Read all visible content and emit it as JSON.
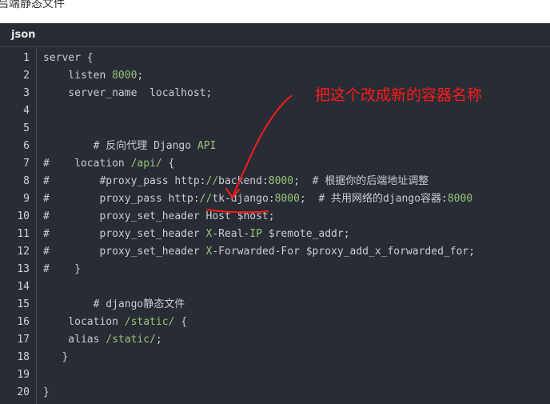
{
  "page": {
    "top_text": "吕端静态文件"
  },
  "code_block": {
    "language": "json",
    "lines": [
      {
        "n": "1",
        "tokens": [
          {
            "t": "server {",
            "c": "t-plain"
          }
        ]
      },
      {
        "n": "2",
        "tokens": [
          {
            "t": "    listen ",
            "c": "t-plain"
          },
          {
            "t": "8000",
            "c": "t-num"
          },
          {
            "t": ";",
            "c": "t-plain"
          }
        ]
      },
      {
        "n": "3",
        "tokens": [
          {
            "t": "    server_name  localhost;",
            "c": "t-plain"
          }
        ]
      },
      {
        "n": "4",
        "tokens": []
      },
      {
        "n": "5",
        "tokens": []
      },
      {
        "n": "6",
        "tokens": [
          {
            "t": "        # 反向代理 Django ",
            "c": "t-plain"
          },
          {
            "t": "API",
            "c": "t-green"
          }
        ]
      },
      {
        "n": "7",
        "tokens": [
          {
            "t": "#    location ",
            "c": "t-plain"
          },
          {
            "t": "/api/",
            "c": "t-green"
          },
          {
            "t": " {",
            "c": "t-plain"
          }
        ]
      },
      {
        "n": "8",
        "tokens": [
          {
            "t": "#        #proxy_pass http:",
            "c": "t-plain"
          },
          {
            "t": "//",
            "c": "t-green"
          },
          {
            "t": "backend:",
            "c": "t-plain"
          },
          {
            "t": "8000",
            "c": "t-num"
          },
          {
            "t": ";  # 根据你的后端地址调整",
            "c": "t-plain"
          }
        ]
      },
      {
        "n": "9",
        "tokens": [
          {
            "t": "#        proxy_pass http:",
            "c": "t-plain"
          },
          {
            "t": "//",
            "c": "t-green"
          },
          {
            "t": "tk-django:",
            "c": "t-plain"
          },
          {
            "t": "8000",
            "c": "t-num"
          },
          {
            "t": ";  # 共用网络的django容器:",
            "c": "t-plain"
          },
          {
            "t": "8000",
            "c": "t-num"
          }
        ]
      },
      {
        "n": "10",
        "tokens": [
          {
            "t": "#        proxy_set_header Host $host;",
            "c": "t-plain"
          }
        ]
      },
      {
        "n": "11",
        "tokens": [
          {
            "t": "#        proxy_set_header ",
            "c": "t-plain"
          },
          {
            "t": "X",
            "c": "t-green"
          },
          {
            "t": "-Real-",
            "c": "t-plain"
          },
          {
            "t": "IP",
            "c": "t-green"
          },
          {
            "t": " $remote_addr;",
            "c": "t-plain"
          }
        ]
      },
      {
        "n": "12",
        "tokens": [
          {
            "t": "#        proxy_set_header ",
            "c": "t-plain"
          },
          {
            "t": "X",
            "c": "t-green"
          },
          {
            "t": "-Forwarded-For $proxy_add_x_forwarded_for;",
            "c": "t-plain"
          }
        ]
      },
      {
        "n": "13",
        "tokens": [
          {
            "t": "#    }",
            "c": "t-plain"
          }
        ]
      },
      {
        "n": "14",
        "tokens": []
      },
      {
        "n": "15",
        "tokens": [
          {
            "t": "        # django静态文件",
            "c": "t-plain"
          }
        ]
      },
      {
        "n": "16",
        "tokens": [
          {
            "t": "    location ",
            "c": "t-plain"
          },
          {
            "t": "/static/",
            "c": "t-green"
          },
          {
            "t": " {",
            "c": "t-plain"
          }
        ]
      },
      {
        "n": "17",
        "tokens": [
          {
            "t": "    alias ",
            "c": "t-plain"
          },
          {
            "t": "/static/",
            "c": "t-green"
          },
          {
            "t": ";",
            "c": "t-plain"
          }
        ]
      },
      {
        "n": "18",
        "tokens": [
          {
            "t": "   }",
            "c": "t-plain"
          }
        ]
      },
      {
        "n": "19",
        "tokens": []
      },
      {
        "n": "20",
        "tokens": [
          {
            "t": "}",
            "c": "t-plain"
          }
        ]
      }
    ]
  },
  "annotation": {
    "text": "把这个改成新的容器名称",
    "color": "#ff1a1a"
  }
}
